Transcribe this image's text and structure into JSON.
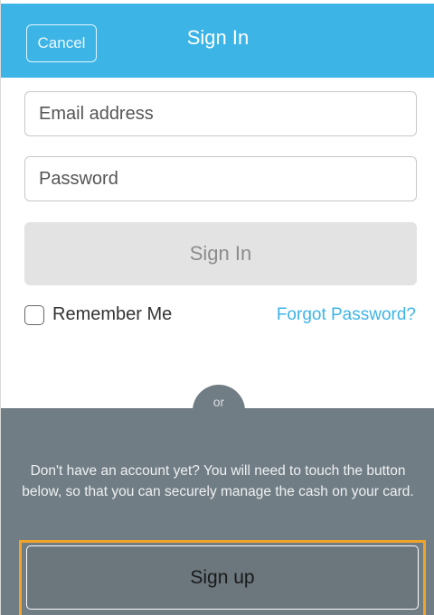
{
  "header": {
    "cancel_label": "Cancel",
    "title": "Sign In"
  },
  "form": {
    "email": {
      "placeholder": "Email address",
      "value": ""
    },
    "password": {
      "placeholder": "Password",
      "value": ""
    },
    "signin_label": "Sign In",
    "remember_label": "Remember Me",
    "remember_checked": false,
    "forgot_label": "Forgot Password?"
  },
  "divider": {
    "or_label": "or"
  },
  "signup": {
    "info_text": "Don't have an account yet? You will need to touch the button below, so that you can securely manage the cash on your card.",
    "button_label": "Sign up"
  },
  "colors": {
    "header_blue": "#3db4e6",
    "link_blue": "#3db4e6",
    "bottom_gray": "#717d84",
    "highlight_orange": "#f0a52a"
  }
}
